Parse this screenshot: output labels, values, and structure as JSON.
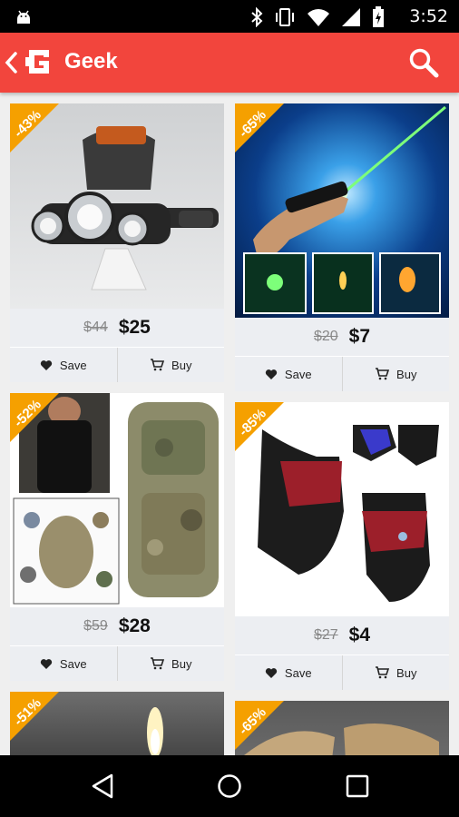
{
  "status_bar": {
    "time": "3:52"
  },
  "app_bar": {
    "title": "Geek"
  },
  "products": [
    {
      "discount": "-43%",
      "old_price": "$44",
      "price": "$25",
      "save_label": "Save",
      "buy_label": "Buy",
      "image": "headlamp"
    },
    {
      "discount": "-65%",
      "old_price": "$20",
      "price": "$7",
      "save_label": "Save",
      "buy_label": "Buy",
      "image": "green-laser-pointer"
    },
    {
      "discount": "-52%",
      "old_price": "$59",
      "price": "$28",
      "save_label": "Save",
      "buy_label": "Buy",
      "image": "camo-backpack"
    },
    {
      "discount": "-85%",
      "old_price": "$27",
      "price": "$4",
      "save_label": "Save",
      "buy_label": "Buy",
      "image": "face-masks"
    },
    {
      "discount": "-51%",
      "image": "lighter-flame"
    },
    {
      "discount": "-65%",
      "image": "tactical-gloves"
    }
  ],
  "colors": {
    "accent": "#f2453d",
    "ribbon": "#f5a000",
    "card_bar": "#eceef2"
  }
}
